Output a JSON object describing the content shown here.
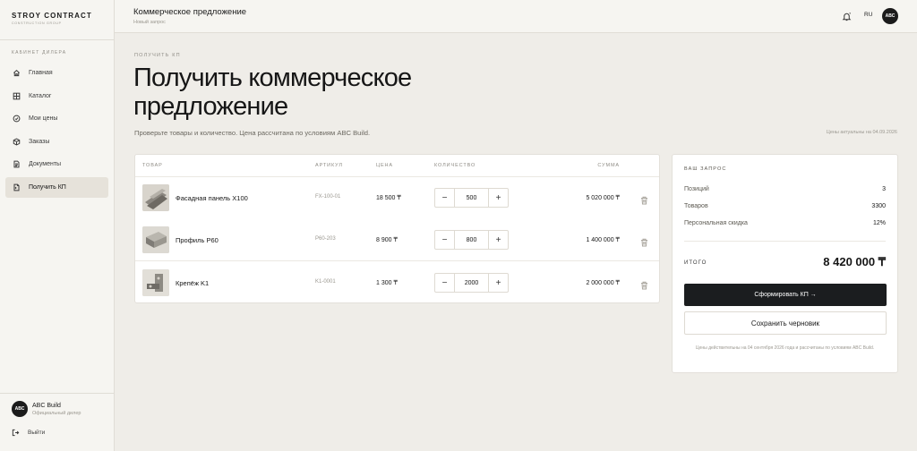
{
  "sidebar": {
    "brand_name": "STROY CONTRACT",
    "brand_sub": "CONSTRUCTION GROUP",
    "section_label": "КАБИНЕТ ДИЛЕРА",
    "items": [
      {
        "label": "Главная",
        "icon": "home-icon"
      },
      {
        "label": "Каталог",
        "icon": "grid-icon"
      },
      {
        "label": "Мои цены",
        "icon": "price-tag-icon"
      },
      {
        "label": "Заказы",
        "icon": "box-icon"
      },
      {
        "label": "Документы",
        "icon": "document-icon"
      },
      {
        "label": "Получить КП",
        "icon": "file-quote-icon"
      }
    ],
    "active_index": 5,
    "user": {
      "initials": "ABC",
      "name": "ABC Build",
      "role": "Официальный дилер"
    },
    "logout_label": "Выйти"
  },
  "topbar": {
    "title": "Коммерческое предложение",
    "subtitle": "Новый запрос",
    "lang": "RU",
    "avatar_initials": "ABC"
  },
  "main": {
    "eyebrow": "ПОЛУЧИТЬ КП",
    "title_line1": "Получить коммерческое",
    "title_line2": "предложение",
    "subtitle": "Проверьте товары и количество. Цена рассчитана по условиям ABC Build.",
    "updated_note": "Цены актуальны на 04.09.2026"
  },
  "table": {
    "headers": {
      "product": "ТОВАР",
      "sku": "АРТИКУЛ",
      "price": "ЦЕНА",
      "qty": "КОЛИЧЕСТВО",
      "sum": "СУММА"
    },
    "rows": [
      {
        "name": "Фасадная панель X100",
        "sku": "FX-100-01",
        "price": "18 500 ₸",
        "qty": "500",
        "sum": "5 020 000 ₸"
      },
      {
        "name": "Профиль P60",
        "sku": "P60-203",
        "price": "8 900 ₸",
        "qty": "800",
        "sum": "1 400 000 ₸"
      },
      {
        "name": "Крепёж K1",
        "sku": "K1-0001",
        "price": "1 300 ₸",
        "qty": "2000",
        "sum": "2 000 000 ₸"
      }
    ],
    "minus": "−",
    "plus": "+"
  },
  "summary": {
    "title": "ВАШ ЗАПРОС",
    "positions_label": "Позиций",
    "positions_value": "3",
    "goods_label": "Товаров",
    "goods_value": "3300",
    "discount_label": "Персональная скидка",
    "discount_value": "12%",
    "total_label": "ИТОГО",
    "total_value": "8 420 000 ₸",
    "primary_button": "Сформировать КП →",
    "secondary_button": "Сохранить черновик",
    "note": "Цены действительны на 04 сентября 2026 года и рассчитаны по условиям ABC Build."
  },
  "colors": {
    "accent": "#1b1d1f",
    "background": "#efede8",
    "active_nav": "#e6e2da"
  }
}
